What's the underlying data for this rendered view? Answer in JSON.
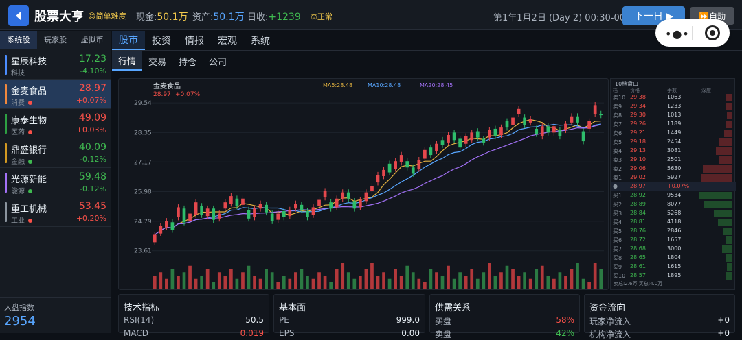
{
  "header": {
    "title": "股票大亨",
    "difficulty": "😊简单难度",
    "cash_label": "现金:",
    "cash_value": "50.1万",
    "assets_label": "资产:",
    "assets_value": "50.1万",
    "daily_label": "日收:",
    "daily_value": "+1239",
    "status": "⚖正常",
    "datetime": "第1年1月2日 (Day 2) 00:30-00",
    "next_day_label": "下一日 ▶",
    "auto_label": "⏩自动"
  },
  "sidebar": {
    "tabs": [
      "系统股",
      "玩家股",
      "虚拟币"
    ],
    "active_tab": 0,
    "stocks": [
      {
        "name": "星辰科技",
        "sector": "科技",
        "price": "17.23",
        "pct": "-4.10%",
        "dir": "down",
        "bar": "#4c8dff",
        "dot": ""
      },
      {
        "name": "金麦食品",
        "sector": "消费",
        "price": "28.97",
        "pct": "+0.07%",
        "dir": "up",
        "bar": "#f0883e",
        "dot": "#f85149",
        "selected": true
      },
      {
        "name": "康泰生物",
        "sector": "医药",
        "price": "49.09",
        "pct": "+0.03%",
        "dir": "up",
        "bar": "#2ea043",
        "dot": "#f85149"
      },
      {
        "name": "鼎盛银行",
        "sector": "金融",
        "price": "40.09",
        "pct": "-0.12%",
        "dir": "down",
        "bar": "#d29922",
        "dot": "#3fb950"
      },
      {
        "name": "光源新能",
        "sector": "能源",
        "price": "59.48",
        "pct": "-0.12%",
        "dir": "down",
        "bar": "#a371f7",
        "dot": "#3fb950"
      },
      {
        "name": "重工机械",
        "sector": "工业",
        "price": "53.45",
        "pct": "+0.20%",
        "dir": "up",
        "bar": "#8b949e",
        "dot": "#f85149"
      }
    ],
    "index_label": "大盘指数",
    "index_value": "2954"
  },
  "main_nav": [
    "股市",
    "投资",
    "情报",
    "宏观",
    "系统"
  ],
  "sub_nav": [
    "行情",
    "交易",
    "持仓",
    "公司"
  ],
  "chart_data": {
    "type": "candlestick",
    "title": "金麦食品",
    "price": "28.97",
    "change": "+0.07%",
    "ma_labels": [
      "MA5:28.48",
      "MA10:28.48",
      "MA20:28.45"
    ],
    "ma_colors": [
      "#e3b341",
      "#58a6ff",
      "#a371f7"
    ],
    "y_ticks": [
      "29.54",
      "28.35",
      "27.17",
      "25.98",
      "24.79",
      "23.61"
    ],
    "ylim": [
      23.3,
      29.9
    ],
    "candles": [
      [
        23.95,
        24.25
      ],
      [
        24.3,
        24.6
      ],
      [
        24.55,
        24.8
      ],
      [
        24.75,
        24.45
      ],
      [
        24.95,
        25.35
      ],
      [
        25.3,
        24.75
      ],
      [
        24.8,
        25.1
      ],
      [
        25.05,
        25.55
      ],
      [
        25.4,
        25.05
      ],
      [
        25.0,
        25.3
      ],
      [
        25.3,
        24.85
      ],
      [
        24.9,
        25.1
      ],
      [
        25.3,
        25.55
      ],
      [
        25.5,
        25.8
      ],
      [
        25.7,
        25.4
      ],
      [
        25.45,
        25.7
      ],
      [
        25.25,
        24.9
      ],
      [
        24.95,
        25.3
      ],
      [
        25.3,
        25.5
      ],
      [
        25.45,
        25.15
      ],
      [
        25.1,
        24.8
      ],
      [
        24.85,
        25.1
      ],
      [
        25.2,
        24.95
      ],
      [
        25.0,
        25.25
      ],
      [
        25.3,
        25.5
      ],
      [
        25.45,
        25.25
      ],
      [
        25.2,
        24.95
      ],
      [
        25.05,
        25.35
      ],
      [
        25.4,
        25.65
      ],
      [
        25.75,
        26.0
      ],
      [
        25.55,
        25.3
      ],
      [
        25.35,
        25.7
      ],
      [
        25.7,
        25.95
      ],
      [
        25.95,
        25.7
      ],
      [
        25.6,
        25.3
      ],
      [
        25.35,
        25.65
      ],
      [
        25.6,
        25.95
      ],
      [
        26.0,
        26.2
      ],
      [
        26.35,
        26.65
      ],
      [
        26.6,
        26.85
      ],
      [
        27.1,
        26.75
      ],
      [
        26.9,
        27.2
      ],
      [
        27.15,
        27.45
      ],
      [
        27.2,
        26.95
      ],
      [
        26.95,
        26.7
      ],
      [
        26.9,
        27.25
      ],
      [
        27.3,
        27.65
      ],
      [
        27.75,
        27.45
      ],
      [
        27.6,
        27.9
      ],
      [
        28.05,
        27.85
      ],
      [
        27.95,
        28.25
      ],
      [
        28.35,
        28.05
      ],
      [
        28.1,
        27.75
      ],
      [
        27.9,
        28.2
      ],
      [
        28.05,
        28.35
      ],
      [
        28.4,
        28.15
      ],
      [
        28.1,
        27.95
      ],
      [
        28.15,
        28.45
      ],
      [
        28.5,
        28.2
      ],
      [
        28.25,
        28.55
      ],
      [
        28.8,
        28.55
      ],
      [
        28.65,
        28.95
      ],
      [
        29.1,
        29.3
      ],
      [
        28.95,
        28.65
      ],
      [
        28.75,
        28.9
      ],
      [
        28.5,
        28.3
      ],
      [
        28.2,
        28.6
      ],
      [
        28.6,
        28.35
      ],
      [
        28.35,
        28.6
      ],
      [
        28.45,
        28.2
      ],
      [
        28.45,
        28.7
      ],
      [
        28.75,
        29.0
      ],
      [
        29.0,
        28.75
      ],
      [
        28.4,
        28.0
      ],
      [
        28.5,
        28.8
      ],
      [
        29.1,
        29.45
      ],
      [
        29.1,
        29.05
      ]
    ],
    "volumes": [
      4,
      5,
      3,
      6,
      4,
      5,
      7,
      3,
      4,
      6,
      2,
      5,
      4,
      6,
      3,
      5,
      7,
      4,
      3,
      6,
      5,
      2,
      4,
      3,
      5,
      6,
      4,
      3,
      5,
      4,
      2,
      6,
      8,
      5,
      3,
      4,
      6,
      8,
      4,
      5,
      3,
      6,
      4,
      7,
      5,
      3,
      2,
      6,
      5,
      4,
      7,
      3,
      5,
      4,
      6,
      3,
      5,
      8,
      4,
      5,
      7,
      6,
      4,
      5,
      3,
      6,
      7,
      4,
      3,
      5,
      4,
      6,
      8,
      3,
      2,
      8,
      6
    ]
  },
  "orderbook": {
    "title": "10档盘口",
    "headers": [
      "档",
      "价格",
      "手数",
      "深度"
    ],
    "asks": [
      {
        "lab": "卖10",
        "price": "29.38",
        "vol": "1063",
        "depth": 0.18
      },
      {
        "lab": "卖9",
        "price": "29.34",
        "vol": "1233",
        "depth": 0.2
      },
      {
        "lab": "卖8",
        "price": "29.30",
        "vol": "1013",
        "depth": 0.17
      },
      {
        "lab": "卖7",
        "price": "29.26",
        "vol": "1189",
        "depth": 0.19
      },
      {
        "lab": "卖6",
        "price": "29.21",
        "vol": "1449",
        "depth": 0.24
      },
      {
        "lab": "卖5",
        "price": "29.18",
        "vol": "2454",
        "depth": 0.4
      },
      {
        "lab": "卖4",
        "price": "29.13",
        "vol": "3081",
        "depth": 0.5
      },
      {
        "lab": "卖3",
        "price": "29.10",
        "vol": "2501",
        "depth": 0.41
      },
      {
        "lab": "卖2",
        "price": "29.06",
        "vol": "5630",
        "depth": 0.9
      },
      {
        "lab": "卖1",
        "price": "29.02",
        "vol": "5927",
        "depth": 0.95
      }
    ],
    "current": {
      "lab": "●",
      "price": "28.97",
      "pct": "+0.07%"
    },
    "bids": [
      {
        "lab": "买1",
        "price": "28.92",
        "vol": "9534",
        "depth": 1.0
      },
      {
        "lab": "买2",
        "price": "28.89",
        "vol": "8077",
        "depth": 0.86
      },
      {
        "lab": "买3",
        "price": "28.84",
        "vol": "5268",
        "depth": 0.56
      },
      {
        "lab": "买4",
        "price": "28.81",
        "vol": "4118",
        "depth": 0.44
      },
      {
        "lab": "买5",
        "price": "28.76",
        "vol": "2846",
        "depth": 0.3
      },
      {
        "lab": "买6",
        "price": "28.72",
        "vol": "1657",
        "depth": 0.18
      },
      {
        "lab": "买7",
        "price": "28.68",
        "vol": "3000",
        "depth": 0.32
      },
      {
        "lab": "买8",
        "price": "28.65",
        "vol": "1804",
        "depth": 0.19
      },
      {
        "lab": "买9",
        "price": "28.61",
        "vol": "1615",
        "depth": 0.17
      },
      {
        "lab": "买10",
        "price": "28.57",
        "vol": "1895",
        "depth": 0.2
      }
    ],
    "footer": "卖总:2.6万  买总:4.0万"
  },
  "panels": {
    "tech": {
      "title": "技术指标",
      "row1_label": "RSI(14)",
      "row1_value": "50.5",
      "row2_label": "MACD",
      "row2_value": "0.019"
    },
    "fund": {
      "title": "基本面",
      "row1_label": "PE",
      "row1_value": "999.0",
      "row2_label": "EPS",
      "row2_value": "0.00"
    },
    "supply": {
      "title": "供需关系",
      "row1_label": "买盘",
      "row1_value": "58%",
      "row2_label": "卖盘",
      "row2_value": "42%"
    },
    "flow": {
      "title": "资金流向",
      "row1_label": "玩家净流入",
      "row1_value": "+0",
      "row2_label": "机构净流入",
      "row2_value": "+0"
    }
  },
  "colors": {
    "up": "#f85149",
    "down": "#3fb950",
    "accent": "#58a6ff"
  }
}
